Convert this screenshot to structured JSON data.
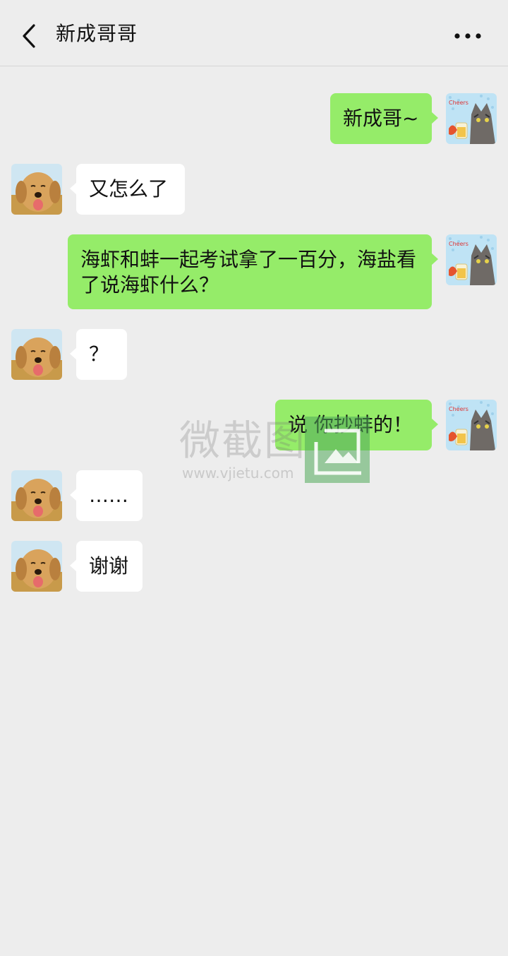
{
  "header": {
    "title": "新成哥哥",
    "back_icon": "chevron-left-icon",
    "more_icon": "more-dots-icon"
  },
  "messages": [
    {
      "side": "right",
      "text": "新成哥~",
      "avatar": "cat-avatar"
    },
    {
      "side": "left",
      "text": "又怎么了",
      "avatar": "dog-avatar"
    },
    {
      "side": "right",
      "text": "海虾和蚌一起考试拿了一百分，海盐看了说海虾什么？",
      "avatar": "cat-avatar"
    },
    {
      "side": "left",
      "text": "？",
      "avatar": "dog-avatar"
    },
    {
      "side": "right",
      "text": "说 你抄蚌的！",
      "avatar": "cat-avatar"
    },
    {
      "side": "left",
      "text": "……",
      "avatar": "dog-avatar"
    },
    {
      "side": "left",
      "text": "谢谢",
      "avatar": "dog-avatar"
    }
  ],
  "watermark": {
    "text": "微截图",
    "url": "www.vjietu.com"
  },
  "colors": {
    "background": "#ededed",
    "sent_bubble": "#95ec69",
    "received_bubble": "#ffffff"
  }
}
